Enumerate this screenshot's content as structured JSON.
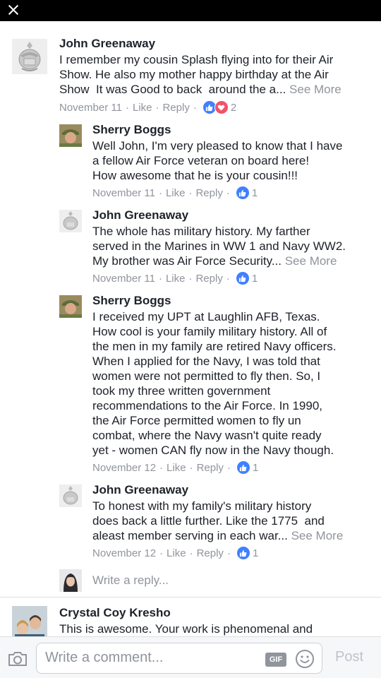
{
  "window": {
    "close_icon": "close-icon"
  },
  "comments": [
    {
      "author": "John Greenaway",
      "lines": [
        "I remember my cousin Splash flying into for their Air",
        "Show. He also my mother happy birthday at the Air",
        "Show  It was Good to back  around the a... "
      ],
      "see_more": "See More",
      "date": "November 11",
      "like": "Like",
      "reply": "Reply",
      "reactions": [
        "like",
        "love"
      ],
      "reaction_count": "2"
    },
    {
      "author": "Sherry Boggs",
      "lines": [
        "Well John, I'm very pleased to know that I have",
        "a fellow Air Force veteran on board here!",
        "How awesome that he is your cousin!!!"
      ],
      "date": "November 11",
      "like": "Like",
      "reply": "Reply",
      "reactions": [
        "like"
      ],
      "reaction_count": "1"
    },
    {
      "author": "John Greenaway",
      "lines": [
        "The whole has military history. My farther",
        "served in the Marines in WW 1 and Navy WW2.",
        "My brother was Air Force Security... "
      ],
      "see_more": "See More",
      "date": "November 11",
      "like": "Like",
      "reply": "Reply",
      "reactions": [
        "like"
      ],
      "reaction_count": "1"
    },
    {
      "author": "Sherry Boggs",
      "lines": [
        "I received my UPT at Laughlin AFB, Texas.",
        "How cool is your family military history. All of",
        "the men in my family are retired Navy officers.",
        "When I applied for the Navy, I was told that",
        "women were not permitted to fly then. So, I",
        "took my three written government",
        "recommendations to the Air Force. In 1990,",
        "the Air Force permitted women to fly un",
        "combat, where the Navy wasn't quite ready",
        "yet - women CAN fly now in the Navy though."
      ],
      "date": "November 12",
      "like": "Like",
      "reply": "Reply",
      "reactions": [
        "like"
      ],
      "reaction_count": "1"
    },
    {
      "author": "John Greenaway",
      "lines": [
        "To honest with my family's military history",
        "does back a little further. Like the 1775  and",
        "aleast member serving in each war... "
      ],
      "see_more": "See More",
      "date": "November 12",
      "like": "Like",
      "reply": "Reply",
      "reactions": [
        "like"
      ],
      "reaction_count": "1"
    },
    {
      "author": "Crystal Coy Kresho",
      "lines": [
        "This is awesome. Your work is phenomenal and"
      ]
    }
  ],
  "reply_box": {
    "placeholder": "Write a reply..."
  },
  "composer": {
    "placeholder": "Write a comment...",
    "gif_label": "GIF",
    "post_label": "Post"
  },
  "colors": {
    "meta_gray": "#90949c",
    "like_blue": "#4080ff",
    "love_red": "#f25268",
    "divider": "#dddfe2"
  }
}
